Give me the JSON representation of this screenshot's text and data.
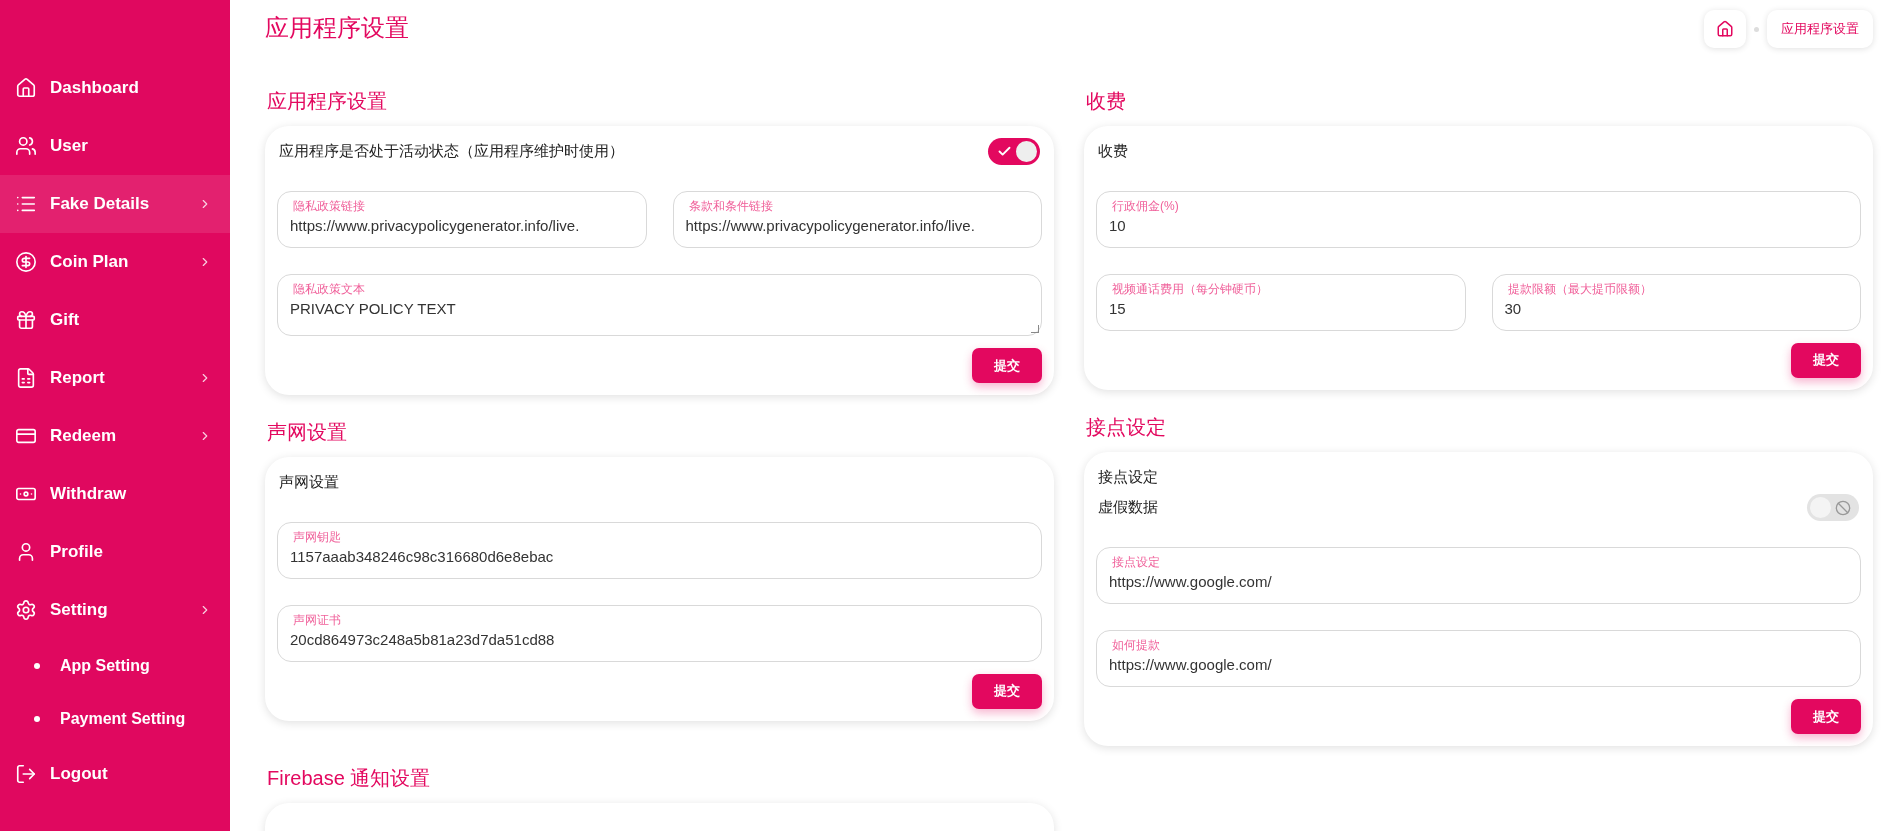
{
  "sidebar": {
    "items": [
      {
        "label": "Dashboard",
        "kind": "item",
        "expandable": false,
        "selected": false
      },
      {
        "label": "User",
        "kind": "item",
        "expandable": false,
        "selected": false
      },
      {
        "label": "Fake Details",
        "kind": "item",
        "expandable": true,
        "selected": true
      },
      {
        "label": "Coin Plan",
        "kind": "item",
        "expandable": true,
        "selected": false
      },
      {
        "label": "Gift",
        "kind": "item",
        "expandable": false,
        "selected": false
      },
      {
        "label": "Report",
        "kind": "item",
        "expandable": true,
        "selected": false
      },
      {
        "label": "Redeem",
        "kind": "item",
        "expandable": true,
        "selected": false
      },
      {
        "label": "Withdraw",
        "kind": "item",
        "expandable": false,
        "selected": false
      },
      {
        "label": "Profile",
        "kind": "item",
        "expandable": false,
        "selected": false
      },
      {
        "label": "Setting",
        "kind": "item",
        "expandable": true,
        "selected": false
      },
      {
        "label": "App Setting",
        "kind": "subitem",
        "selected": false
      },
      {
        "label": "Payment Setting",
        "kind": "subitem",
        "selected": false
      },
      {
        "label": "Logout",
        "kind": "item",
        "expandable": false,
        "selected": false
      }
    ]
  },
  "page_title": "应用程序设置",
  "breadcrumb": {
    "current": "应用程序设置"
  },
  "columns": [
    [
      {
        "title": "应用程序设置",
        "card": {
          "switch": {
            "label": "应用程序是否处于活动状态（应用程序维护时使用）",
            "on": true
          },
          "rows": [
            [
              {
                "kind": "input",
                "label": "隐私政策链接",
                "value": "https://www.privacypolicygenerator.info/live."
              },
              {
                "kind": "input",
                "label": "条款和条件链接",
                "value": "https://www.privacypolicygenerator.info/live."
              }
            ],
            [
              {
                "kind": "textarea",
                "label": "隐私政策文本",
                "value": "PRIVACY POLICY TEXT"
              }
            ]
          ],
          "button": "提交"
        }
      },
      {
        "title": "声网设置",
        "card": {
          "heading": "声网设置",
          "rows": [
            [
              {
                "kind": "input",
                "label": "声网钥匙",
                "value": "1157aaab348246c98c316680d6e8ebac"
              }
            ],
            [
              {
                "kind": "input",
                "label": "声网证书",
                "value": "20cd864973c248a5b81a23d7da51cd88"
              }
            ]
          ],
          "button": "提交"
        }
      },
      {
        "title": "Firebase 通知设置"
      }
    ],
    [
      {
        "title": "收费",
        "card": {
          "heading": "收费",
          "rows": [
            [
              {
                "kind": "input",
                "label": "行政佣金(%)",
                "value": "10"
              }
            ],
            [
              {
                "kind": "input",
                "label": "视频通话费用（每分钟硬币）",
                "value": "15"
              },
              {
                "kind": "input",
                "label": "提款限额（最大提币限额）",
                "value": "30"
              }
            ]
          ],
          "button": "提交"
        }
      },
      {
        "title": "接点设定",
        "card": {
          "heading": "接点设定",
          "switch": {
            "label": "虚假数据",
            "on": false
          },
          "rows": [
            [
              {
                "kind": "input",
                "label": "接点设定",
                "value": "https://www.google.com/"
              }
            ],
            [
              {
                "kind": "input",
                "label": "如何提款",
                "value": "https://www.google.com/"
              }
            ]
          ],
          "button": "提交"
        }
      }
    ]
  ]
}
